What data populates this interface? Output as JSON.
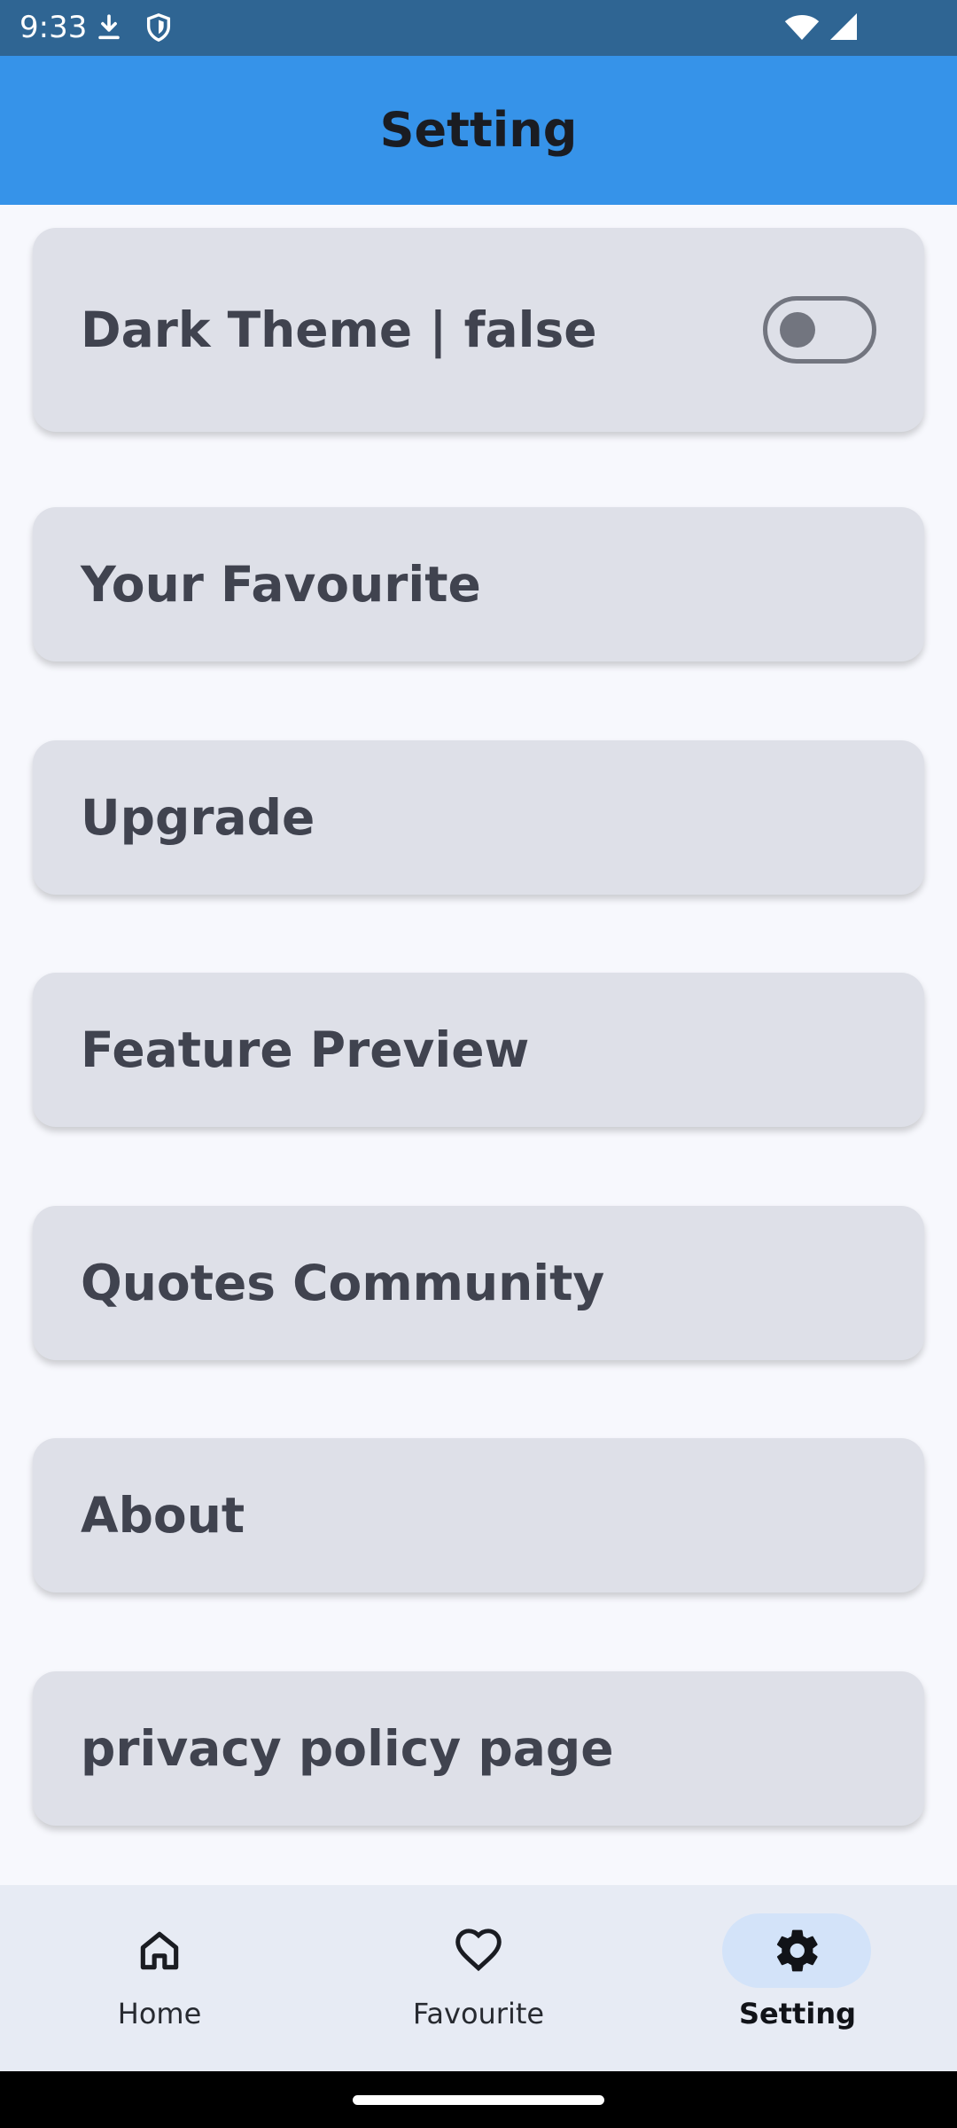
{
  "status_bar": {
    "time": "9:33",
    "icons": [
      "download-icon",
      "shield-icon",
      "wifi-icon",
      "signal-icon"
    ]
  },
  "app_bar": {
    "title": "Setting"
  },
  "settings": {
    "items": [
      {
        "label": "Dark Theme | false",
        "toggle": {
          "on": false
        }
      },
      {
        "label": "Your Favourite"
      },
      {
        "label": "Upgrade"
      },
      {
        "label": "Feature Preview"
      },
      {
        "label": "Quotes Community"
      },
      {
        "label": "About"
      },
      {
        "label": "privacy policy page"
      }
    ]
  },
  "bottom_nav": {
    "items": [
      {
        "label": "Home",
        "icon": "home-icon",
        "active": false
      },
      {
        "label": "Favourite",
        "icon": "heart-icon",
        "active": false
      },
      {
        "label": "Setting",
        "icon": "gear-icon",
        "active": true
      }
    ]
  },
  "colors": {
    "status_bar": "#2f6593",
    "app_bar": "#3693e9",
    "background": "#f7f8fd",
    "card": "#dee0e8",
    "nav_bar": "#e7ebf4",
    "nav_active_pill": "#d3e3f9"
  }
}
